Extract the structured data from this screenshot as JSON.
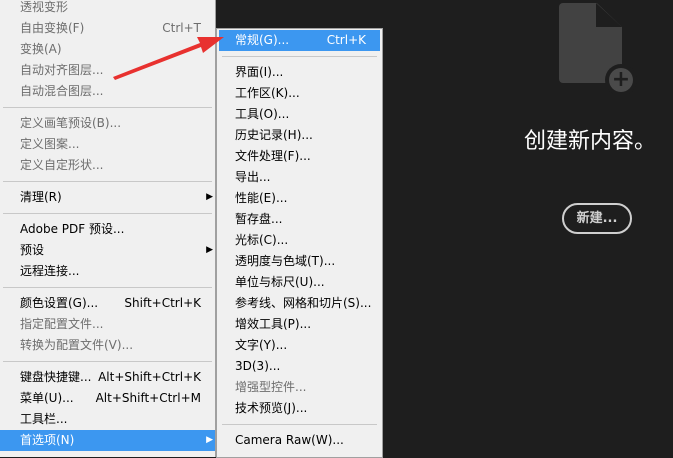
{
  "edit_menu": [
    {
      "label": "透视变形",
      "disabled": true
    },
    {
      "label": "自由变换(F)",
      "shortcut": "Ctrl+T",
      "disabled": true
    },
    {
      "label": "变换(A)",
      "disabled": true
    },
    {
      "label": "自动对齐图层...",
      "disabled": true
    },
    {
      "label": "自动混合图层...",
      "disabled": true
    },
    "sep",
    {
      "label": "定义画笔预设(B)...",
      "disabled": true
    },
    {
      "label": "定义图案...",
      "disabled": true
    },
    {
      "label": "定义自定形状...",
      "disabled": true
    },
    "sep",
    {
      "label": "清理(R)",
      "submenu": true
    },
    "sep",
    {
      "label": "Adobe PDF 预设..."
    },
    {
      "label": "预设",
      "submenu": true
    },
    {
      "label": "远程连接..."
    },
    "sep",
    {
      "label": "颜色设置(G)...",
      "shortcut": "Shift+Ctrl+K"
    },
    {
      "label": "指定配置文件...",
      "disabled": true
    },
    {
      "label": "转换为配置文件(V)...",
      "disabled": true
    },
    "sep",
    {
      "label": "键盘快捷键...",
      "shortcut": "Alt+Shift+Ctrl+K"
    },
    {
      "label": "菜单(U)...",
      "shortcut": "Alt+Shift+Ctrl+M"
    },
    {
      "label": "工具栏..."
    },
    {
      "label": "首选项(N)",
      "submenu": true,
      "highlighted": true
    }
  ],
  "preferences_submenu": [
    {
      "label": "常规(G)...",
      "shortcut": "Ctrl+K",
      "highlighted": true
    },
    "sep",
    {
      "label": "界面(I)..."
    },
    {
      "label": "工作区(K)..."
    },
    {
      "label": "工具(O)..."
    },
    {
      "label": "历史记录(H)..."
    },
    {
      "label": "文件处理(F)..."
    },
    {
      "label": "导出..."
    },
    {
      "label": "性能(E)..."
    },
    {
      "label": "暂存盘..."
    },
    {
      "label": "光标(C)..."
    },
    {
      "label": "透明度与色域(T)..."
    },
    {
      "label": "单位与标尺(U)..."
    },
    {
      "label": "参考线、网格和切片(S)..."
    },
    {
      "label": "增效工具(P)..."
    },
    {
      "label": "文字(Y)..."
    },
    {
      "label": "3D(3)..."
    },
    {
      "label": "增强型控件...",
      "disabled": true
    },
    {
      "label": "技术预览(J)..."
    },
    "sep",
    {
      "label": "Camera Raw(W)..."
    }
  ],
  "home": {
    "title": "创建新内容。",
    "new_button": "新建..."
  },
  "colors": {
    "highlight": "#3c97f0",
    "annotation_arrow": "#e8312f",
    "background": "#1e1e1e"
  }
}
